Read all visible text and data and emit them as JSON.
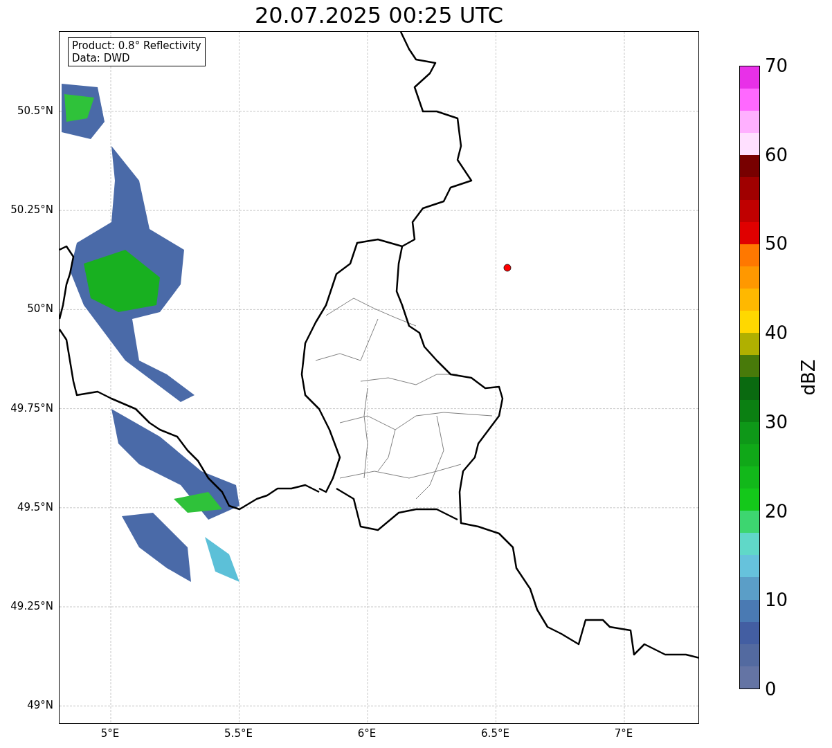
{
  "title": "20.07.2025 00:25 UTC",
  "info_box": {
    "lines": [
      "Product: 0.8° Reflectivity",
      "Data: DWD"
    ]
  },
  "map": {
    "y_ticks": [
      "50.5°N",
      "50.25°N",
      "50°N",
      "49.75°N",
      "49.5°N",
      "49.25°N",
      "49°N"
    ],
    "x_ticks": [
      "5°E",
      "5.5°E",
      "6°E",
      "6.5°E",
      "7°E"
    ]
  },
  "colorbar": {
    "label": "dBZ",
    "ticks": [
      "70",
      "60",
      "50",
      "40",
      "30",
      "20",
      "10",
      "0"
    ],
    "bins": [
      {
        "color": "#6474a4"
      },
      {
        "color": "#536aa0"
      },
      {
        "color": "#435ea2"
      },
      {
        "color": "#4a7ab3"
      },
      {
        "color": "#5b9ec7"
      },
      {
        "color": "#66c2dc"
      },
      {
        "color": "#60d8c8"
      },
      {
        "color": "#3dd670"
      },
      {
        "color": "#14c81a"
      },
      {
        "color": "#12b81a"
      },
      {
        "color": "#10a818"
      },
      {
        "color": "#0e9818"
      },
      {
        "color": "#0b8012"
      },
      {
        "color": "#0a6a10"
      },
      {
        "color": "#487a0a"
      },
      {
        "color": "#b0b000"
      },
      {
        "color": "#ffd800"
      },
      {
        "color": "#ffb800"
      },
      {
        "color": "#ff9800"
      },
      {
        "color": "#ff7800"
      },
      {
        "color": "#e00000"
      },
      {
        "color": "#c00000"
      },
      {
        "color": "#a00000"
      },
      {
        "color": "#780000"
      },
      {
        "color": "#ffe0ff"
      },
      {
        "color": "#ffb0ff"
      },
      {
        "color": "#ff68ff"
      },
      {
        "color": "#e830e8"
      }
    ]
  }
}
